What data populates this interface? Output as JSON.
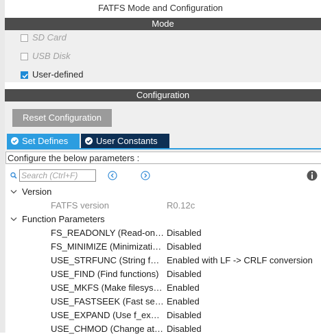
{
  "window": {
    "title": "FATFS Mode and Configuration"
  },
  "mode": {
    "header": "Mode",
    "options": [
      {
        "label": "SD Card",
        "checked": false,
        "enabled": false
      },
      {
        "label": "USB Disk",
        "checked": false,
        "enabled": false
      },
      {
        "label": "User-defined",
        "checked": true,
        "enabled": true
      }
    ]
  },
  "config": {
    "header": "Configuration",
    "reset_label": "Reset Configuration",
    "tabs": [
      {
        "label": "Set Defines",
        "active": true
      },
      {
        "label": "User Constants",
        "active": false
      }
    ],
    "description": "Configure the below parameters :",
    "search_placeholder": "Search (Ctrl+F)",
    "groups": [
      {
        "label": "Version",
        "expanded": true
      },
      {
        "label": "Function Parameters",
        "expanded": true
      }
    ],
    "version_row": {
      "name": "FATFS version",
      "value": "R0.12c"
    },
    "parameters": [
      {
        "name": "FS_READONLY (Read-only mode)",
        "value": "Disabled"
      },
      {
        "name": "FS_MINIMIZE (Minimization level)",
        "value": "Disabled"
      },
      {
        "name": "USE_STRFUNC (String functions)",
        "value": "Enabled with LF -> CRLF conversion"
      },
      {
        "name": "USE_FIND (Find functions)",
        "value": "Disabled"
      },
      {
        "name": "USE_MKFS (Make filesystem function)",
        "value": "Enabled"
      },
      {
        "name": "USE_FASTSEEK (Fast seek function)",
        "value": "Enabled"
      },
      {
        "name": "USE_EXPAND (Use f_expand function)",
        "value": "Disabled"
      },
      {
        "name": "USE_CHMOD (Change attributes function)",
        "value": "Disabled"
      }
    ]
  },
  "colors": {
    "band": "#4c4c4c",
    "tab_active": "#2c9de0",
    "tab_inactive": "#0d2f54",
    "reset_button": "#9b9b9b",
    "checkbox_checked": "#1e8ad6"
  }
}
